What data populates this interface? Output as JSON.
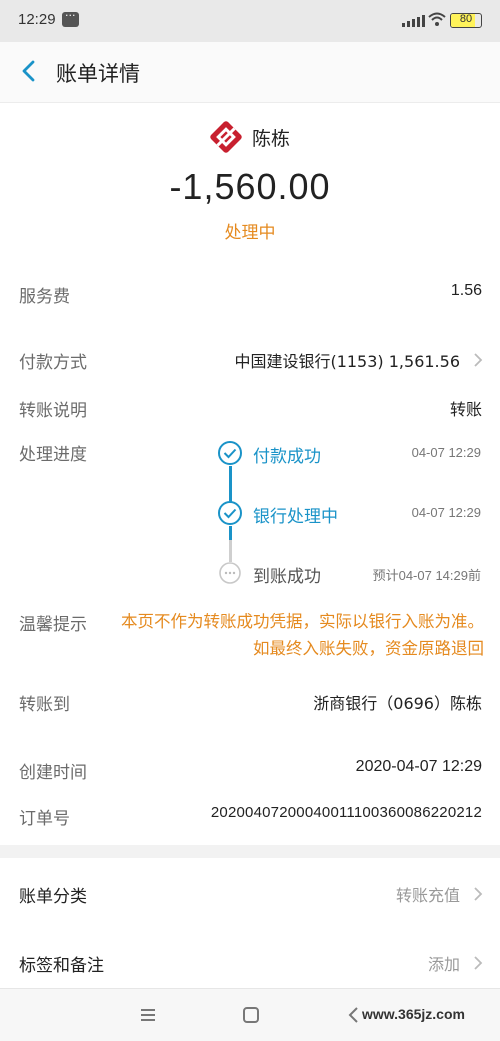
{
  "status_bar": {
    "time": "12:29",
    "battery": "80"
  },
  "header": {
    "title": "账单详情"
  },
  "payee": {
    "name": "陈栋"
  },
  "amount": "-1,560.00",
  "status": "处理中",
  "fields": {
    "service_fee": {
      "label": "服务费",
      "value": "1.56"
    },
    "payment_method": {
      "label": "付款方式",
      "value": "中国建设银行(1153) 1,561.56"
    },
    "transfer_note": {
      "label": "转账说明",
      "value": "转账"
    },
    "progress_label": "处理进度",
    "steps": [
      {
        "label": "付款成功",
        "time": "04-07 12:29",
        "state": "done"
      },
      {
        "label": "银行处理中",
        "time": "04-07 12:29",
        "state": "done"
      },
      {
        "label": "到账成功",
        "time": "预计04-07 14:29前",
        "state": "pending"
      }
    ],
    "tip": {
      "label": "温馨提示",
      "text": "本页不作为转账成功凭据，实际以银行入账为准。如最终入账失败，资金原路退回"
    },
    "transfer_to": {
      "label": "转账到",
      "value": "浙商银行（0696）陈栋"
    },
    "created_time": {
      "label": "创建时间",
      "value": "2020-04-07 12:29"
    },
    "order_no": {
      "label": "订单号",
      "value": "20200407200040011100360086220212"
    }
  },
  "extras": {
    "category": {
      "label": "账单分类",
      "value": "转账充值"
    },
    "tags": {
      "label": "标签和备注",
      "value": "添加"
    }
  },
  "watermark": {
    "url": "www.365jz.com"
  },
  "colors": {
    "accent_blue": "#1a93c8",
    "status_orange": "#e58a1f",
    "logo_red": "#c8202f"
  }
}
